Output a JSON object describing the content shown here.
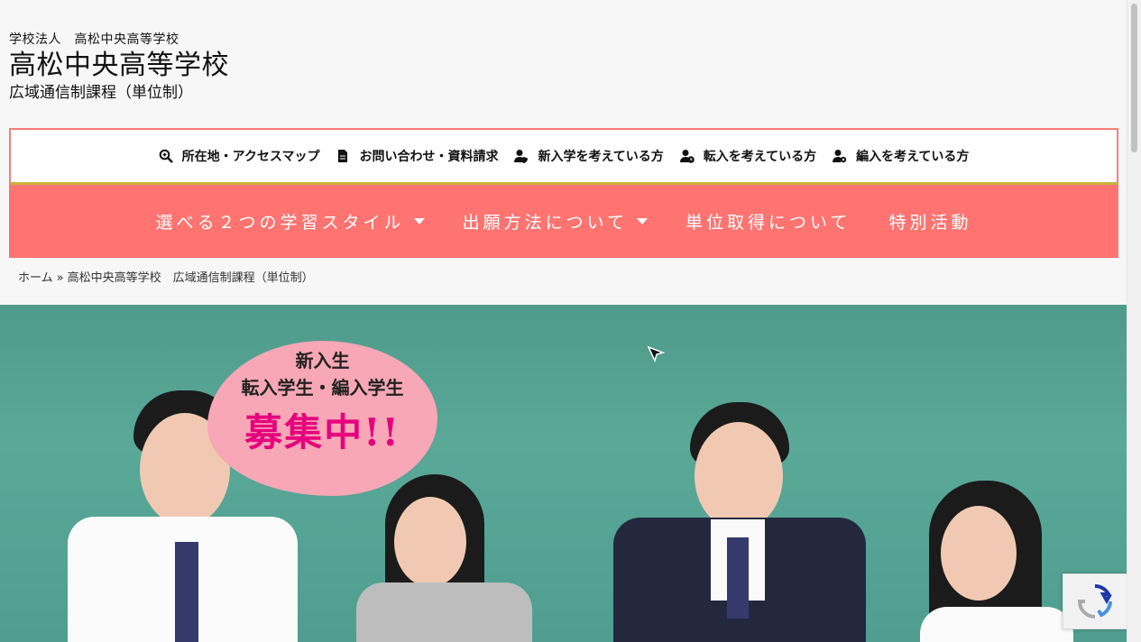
{
  "header": {
    "organization": "学校法人　高松中央高等学校",
    "title": "高松中央高等学校",
    "subtitle": "広域通信制課程（単位制）"
  },
  "topbar": {
    "items": [
      {
        "label": "所在地・アクセスマップ",
        "icon": "search-icon"
      },
      {
        "label": "お問い合わせ・資料請求",
        "icon": "document-icon"
      },
      {
        "label": "新入学を考えている方",
        "icon": "user-shield-icon"
      },
      {
        "label": "転入を考えている方",
        "icon": "user-clock-icon"
      },
      {
        "label": "編入を考えている方",
        "icon": "user-gear-icon"
      }
    ]
  },
  "mainnav": {
    "items": [
      {
        "label": "選べる２つの学習スタイル",
        "dropdown": true
      },
      {
        "label": "出願方法について",
        "dropdown": true
      },
      {
        "label": "単位取得について",
        "dropdown": false
      },
      {
        "label": "特別活動",
        "dropdown": false
      }
    ]
  },
  "breadcrumb": {
    "home": "ホーム",
    "separator": "»",
    "current": "高松中央高等学校　広域通信制課程（単位制）"
  },
  "hero": {
    "bubble_line1": "新入生",
    "bubble_line2": "転入学生・編入学生",
    "bubble_line3": "募集中!!"
  },
  "colors": {
    "accent": "#ff7471",
    "topbar_border": "#ff7b78",
    "bubble": "#f7a7b6",
    "bubble_text": "#e6007e",
    "chalkboard": "#4f9b8b"
  }
}
